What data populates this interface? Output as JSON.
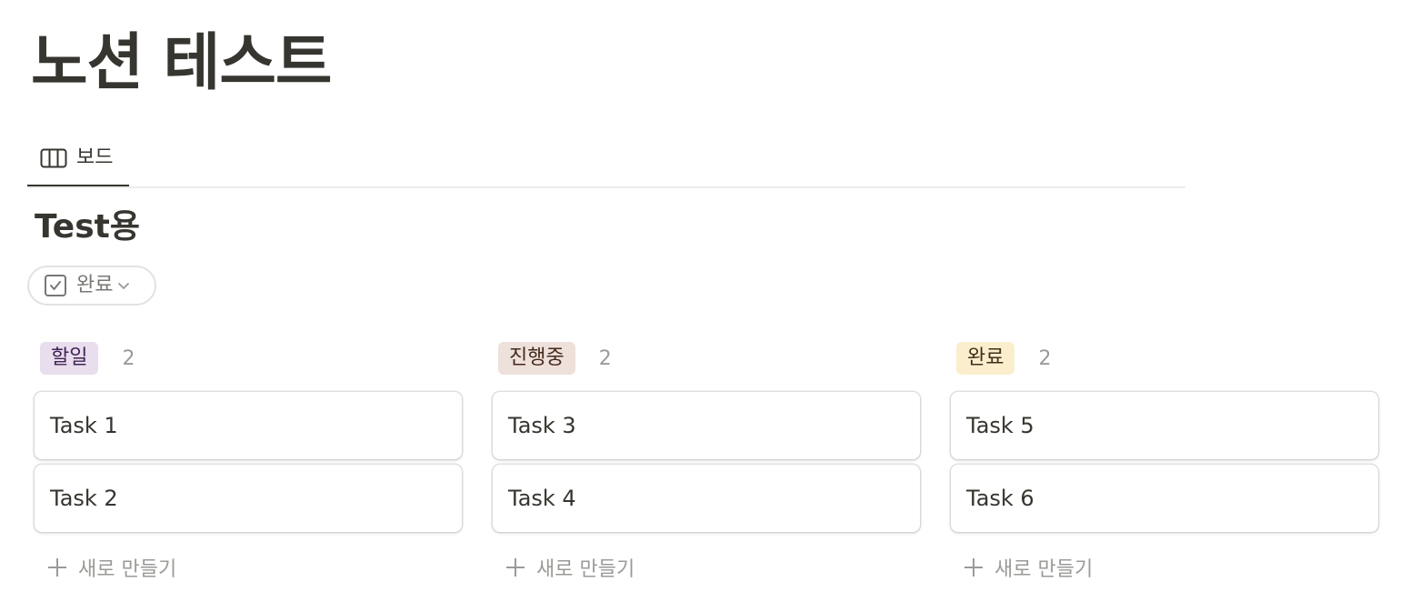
{
  "page": {
    "title": "노션 테스트"
  },
  "view_tabs": [
    {
      "label": "보드",
      "icon": "board-view-icon",
      "active": true
    }
  ],
  "database": {
    "title": "Test용",
    "group_by": {
      "label": "완료",
      "icon": "checkbox-icon"
    }
  },
  "board": {
    "new_label": "새로 만들기",
    "columns": [
      {
        "status": "할일",
        "count": "2",
        "tag_bg": "#e8deee",
        "tag_fg": "#412454",
        "cards": [
          "Task 1",
          "Task 2"
        ]
      },
      {
        "status": "진행중",
        "count": "2",
        "tag_bg": "#eee0da",
        "tag_fg": "#442a1e",
        "cards": [
          "Task 3",
          "Task 4"
        ]
      },
      {
        "status": "완료",
        "count": "2",
        "tag_bg": "#fbeecc",
        "tag_fg": "#402c1b",
        "cards": [
          "Task 5",
          "Task 6"
        ]
      }
    ]
  }
}
